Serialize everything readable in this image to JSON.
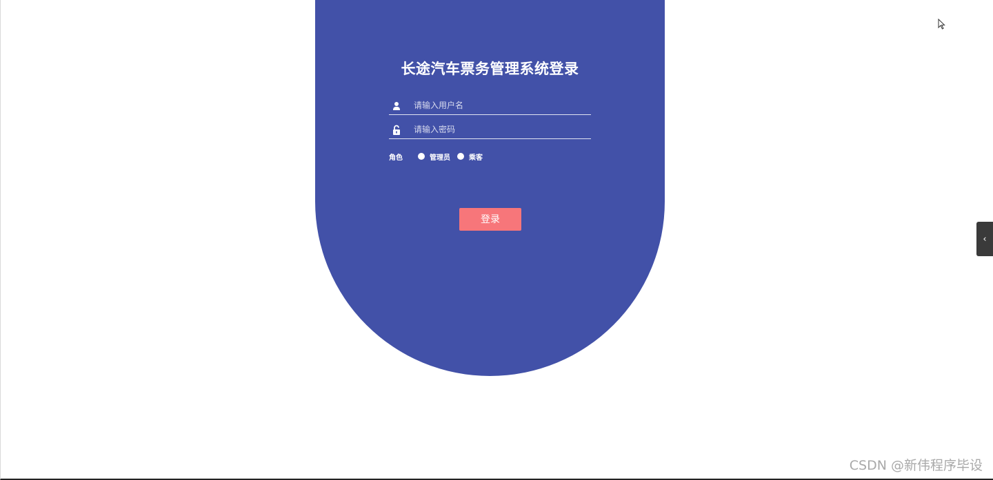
{
  "login": {
    "title": "长途汽车票务管理系统登录",
    "username_placeholder": "请输入用户名",
    "password_placeholder": "请输入密码",
    "role_label": "角色",
    "role_options": [
      "管理员",
      "乘客"
    ],
    "submit_label": "登录"
  },
  "side_tab": {
    "icon": "chevron-left-icon",
    "glyph": "‹"
  },
  "watermark": "CSDN @新伟程序毕设",
  "colors": {
    "panel": "#4251a8",
    "button": "#f7767a",
    "background": "#ffffff"
  }
}
